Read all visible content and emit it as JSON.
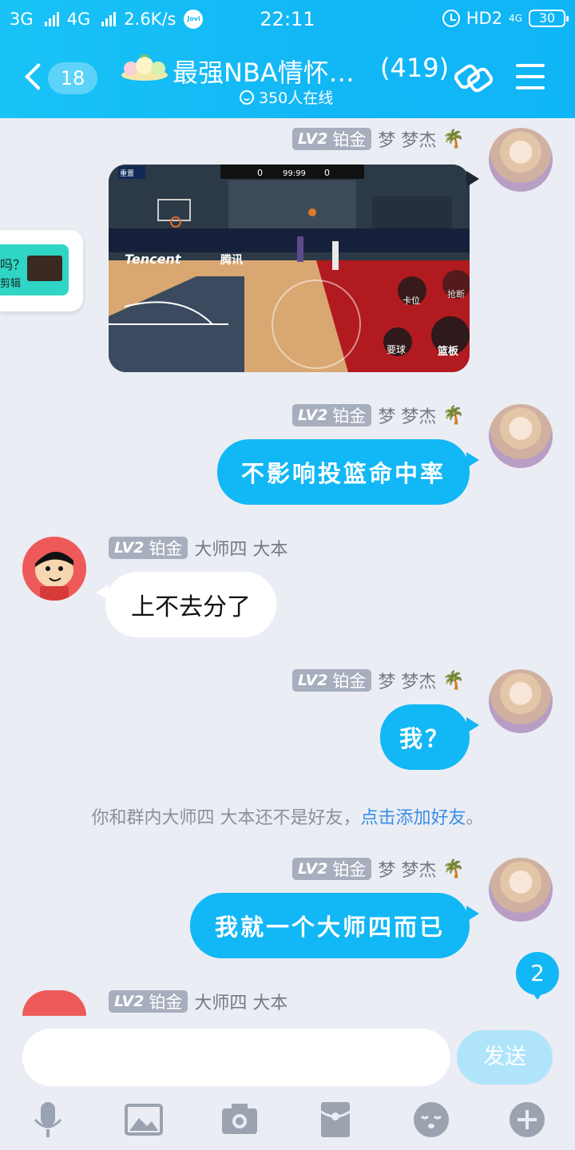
{
  "status_bar": {
    "network_1": "3G",
    "network_2": "4G",
    "speed": "2.6K/s",
    "assistant_badge": "Jovi",
    "time": "22:11",
    "hd": "HD2",
    "net_small": "4G",
    "battery": "30"
  },
  "header": {
    "back_count": "18",
    "group_name": "最强NBA情怀…",
    "member_count": "(419)",
    "online_text": "350人在线"
  },
  "messages": [
    {
      "level": "LV2",
      "rank": "铂金",
      "name": "梦 梦杰",
      "type": "image"
    },
    {
      "level": "LV2",
      "rank": "铂金",
      "name": "梦 梦杰",
      "text": "不影响投篮命中率"
    },
    {
      "level": "LV2",
      "rank": "铂金",
      "name": "大师四  大本",
      "text": "上不去分了"
    },
    {
      "level": "LV2",
      "rank": "铂金",
      "name": "梦 梦杰",
      "text": "我？"
    },
    {
      "level": "LV2",
      "rank": "铂金",
      "name": "梦 梦杰",
      "text": "我就一个大师四而已"
    },
    {
      "level": "LV2",
      "rank": "铂金",
      "name": "大师四  大本"
    }
  ],
  "game_image": {
    "brand": "Tencent",
    "brand_cn": "腾讯",
    "score_home": "0",
    "score_away": "0",
    "clock": "99:99",
    "btn_post": "卡位",
    "btn_steal": "抢断",
    "btn_rebound": "篮板",
    "btn_ball": "要球",
    "btn_pass": "重置"
  },
  "floating_card": {
    "question": "吗？",
    "caption": "剪辑"
  },
  "system_message": {
    "text": "你和群内大师四  大本还不是好友，",
    "link": "点击添加好友",
    "end": "。"
  },
  "unread_count": "2",
  "input": {
    "placeholder": "",
    "send_label": "发送"
  },
  "toolbar": [
    "mic-icon",
    "image-icon",
    "camera-icon",
    "red-packet-icon",
    "emoji-icon",
    "plus-icon"
  ]
}
